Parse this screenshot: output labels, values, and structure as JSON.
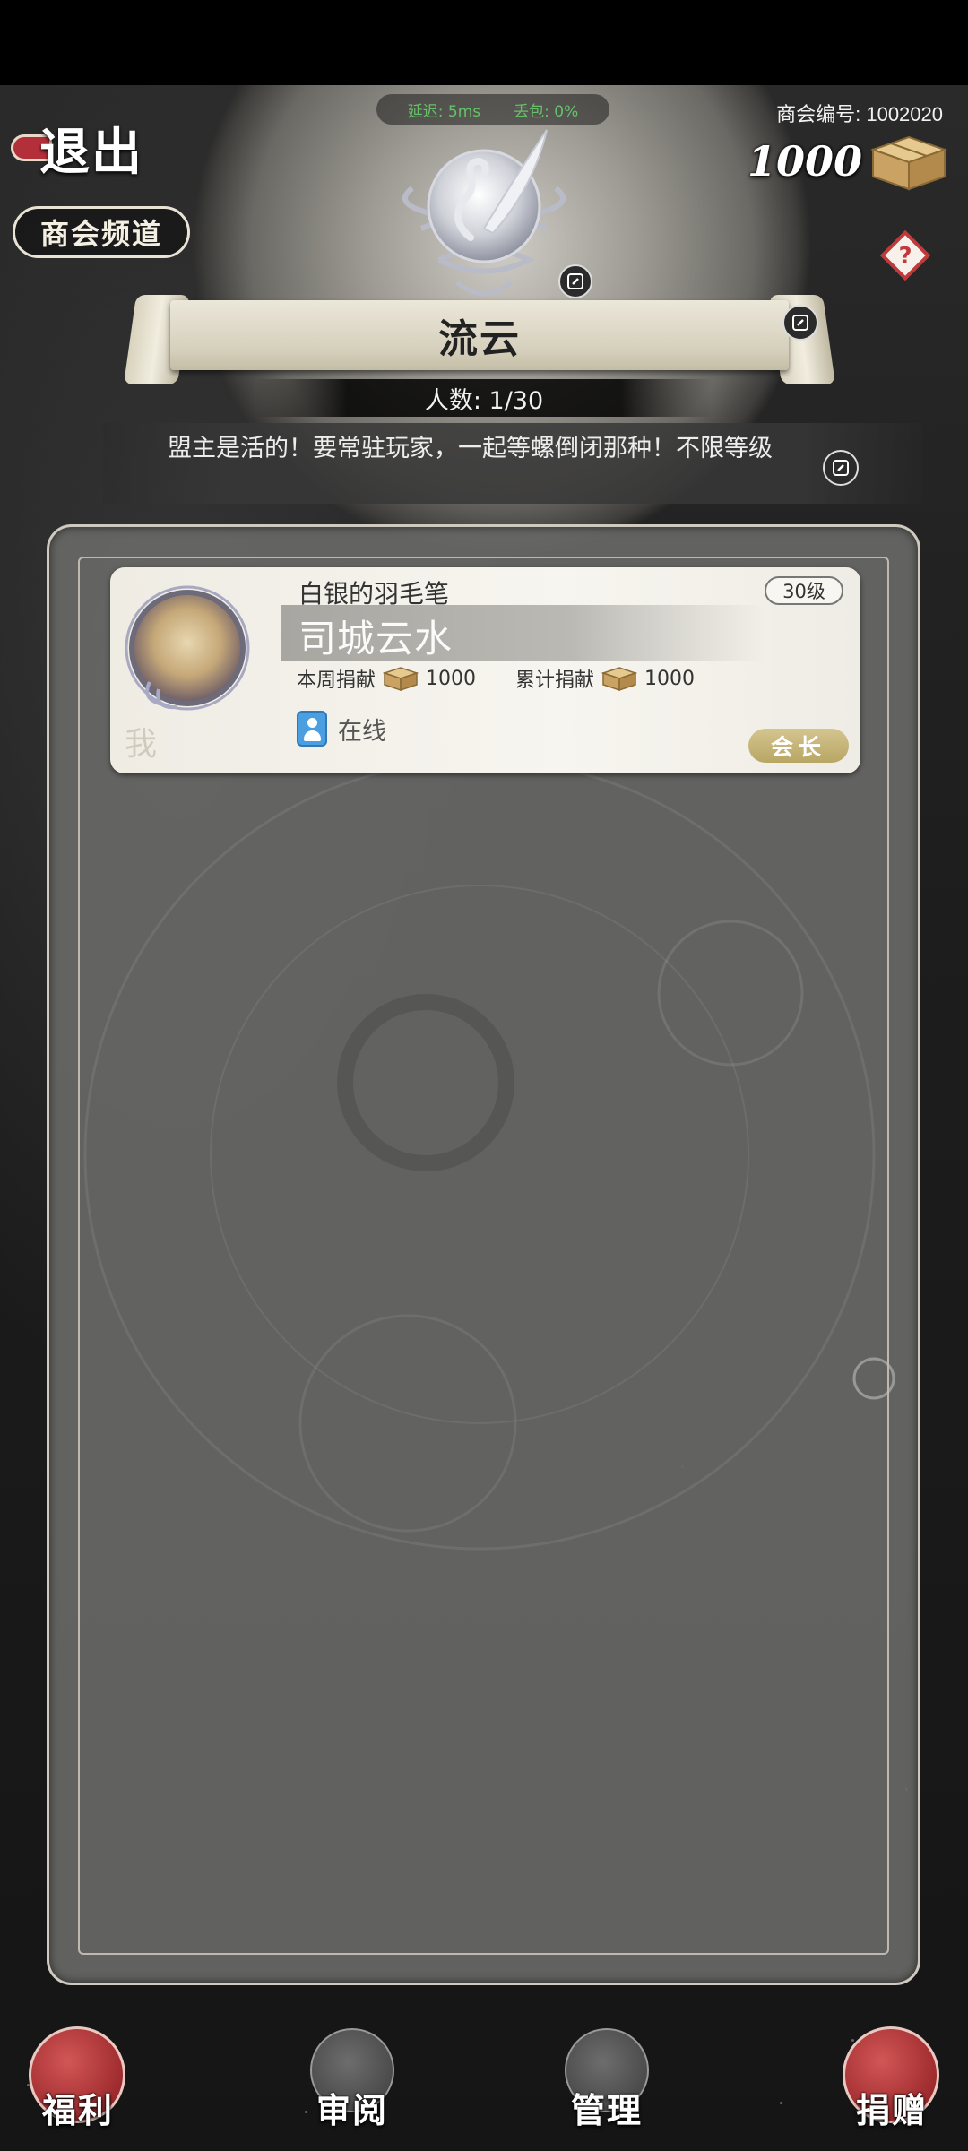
{
  "status": {
    "latency_label": "延迟: 5ms",
    "loss_label": "丢包: 0%"
  },
  "header": {
    "exit_label": "退出",
    "channel_label": "商会频道",
    "guild_id_label": "商会编号: 1002020",
    "currency_amount": "1000",
    "help_icon": "question-icon"
  },
  "guild": {
    "name": "流云",
    "member_count": "人数: 1/30",
    "notice": "盟主是活的！要常驻玩家，一起等螺倒闭那种！不限等级"
  },
  "members": [
    {
      "title": "白银的羽毛笔",
      "level": "30级",
      "name": "司城云水",
      "weekly_label": "本周捐献",
      "weekly_value": "1000",
      "total_label": "累计捐献",
      "total_value": "1000",
      "status": "在线",
      "role": "会长",
      "self_marker": "我"
    }
  ],
  "bottom_nav": [
    {
      "label": "福利",
      "icon": "welfare-seal-icon"
    },
    {
      "label": "审阅",
      "icon": "review-bird-icon"
    },
    {
      "label": "管理",
      "icon": "manage-bird-icon"
    },
    {
      "label": "捐赠",
      "icon": "donate-seal-icon"
    }
  ],
  "colors": {
    "accent_red": "#9e2b2e",
    "online_green": "#66c26a",
    "role_gold": "#c4b273"
  }
}
